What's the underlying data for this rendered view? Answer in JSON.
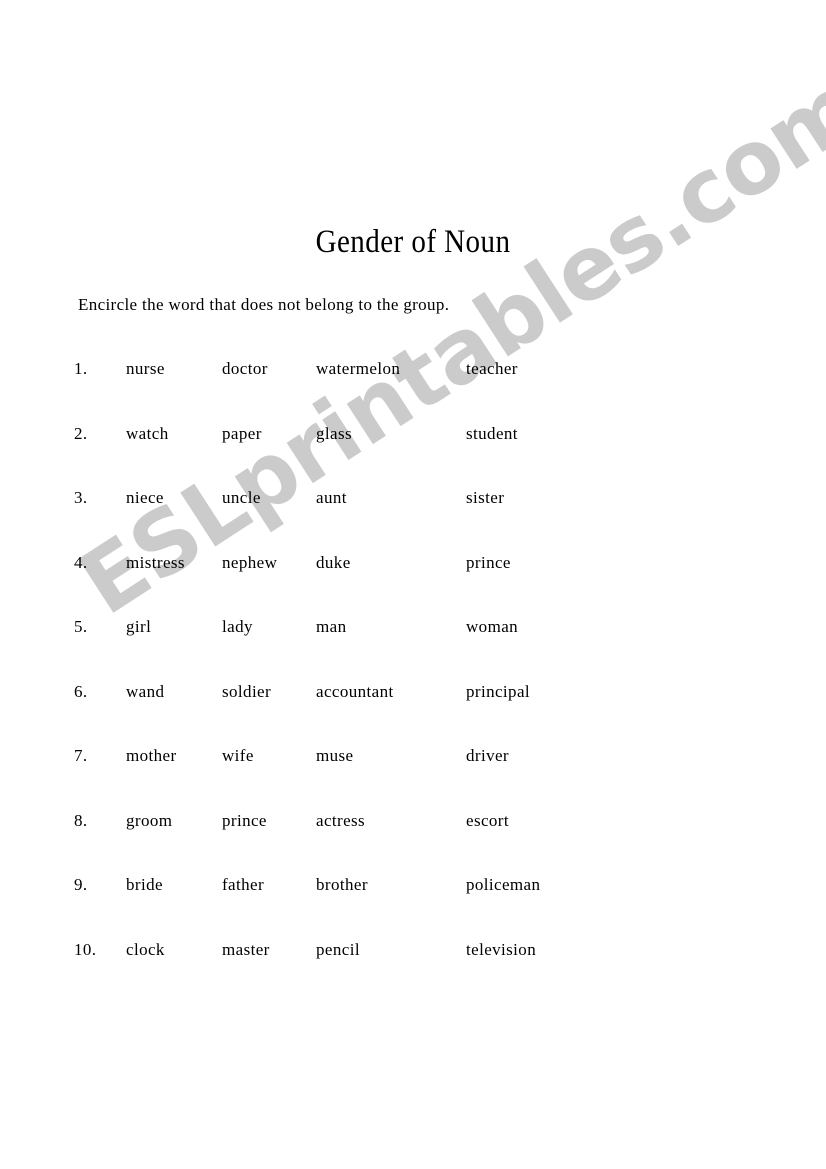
{
  "document": {
    "title": "Gender of Noun",
    "instructions": "Encircle the word that does not belong to the group."
  },
  "watermark": {
    "text": "ESLprintables.com",
    "color": "#cbcbcb"
  },
  "exercise": {
    "rows": [
      {
        "number": "1.",
        "w1": "nurse",
        "w2": "doctor",
        "w3": "watermelon",
        "w4": "teacher"
      },
      {
        "number": "2.",
        "w1": "watch",
        "w2": "paper",
        "w3": "glass",
        "w4": "student"
      },
      {
        "number": "3.",
        "w1": "niece",
        "w2": "uncle",
        "w3": "aunt",
        "w4": "sister"
      },
      {
        "number": "4.",
        "w1": "mistress",
        "w2": "nephew",
        "w3": "duke",
        "w4": "prince"
      },
      {
        "number": "5.",
        "w1": "girl",
        "w2": "lady",
        "w3": "man",
        "w4": "woman"
      },
      {
        "number": "6.",
        "w1": "wand",
        "w2": "soldier",
        "w3": "accountant",
        "w4": "principal"
      },
      {
        "number": "7.",
        "w1": "mother",
        "w2": "wife",
        "w3": "muse",
        "w4": "driver"
      },
      {
        "number": "8.",
        "w1": "groom",
        "w2": "prince",
        "w3": "actress",
        "w4": "escort"
      },
      {
        "number": "9.",
        "w1": "bride",
        "w2": "father",
        "w3": "brother",
        "w4": "policeman"
      },
      {
        "number": "10.",
        "w1": "clock",
        "w2": "master",
        "w3": "pencil",
        "w4": "television"
      }
    ]
  }
}
